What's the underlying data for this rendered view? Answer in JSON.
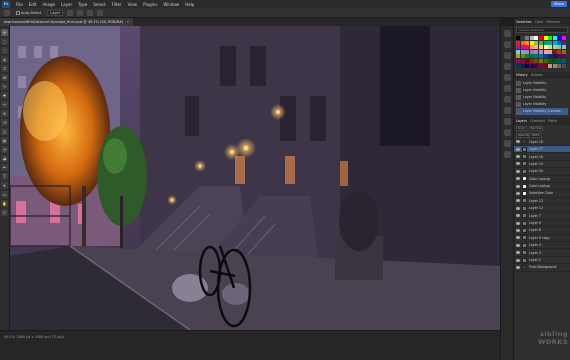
{
  "app": {
    "logo": "Ps"
  },
  "menu": [
    "File",
    "Edit",
    "Image",
    "Layer",
    "Type",
    "Select",
    "Filter",
    "View",
    "Plugins",
    "Window",
    "Help"
  ],
  "share_label": "Share",
  "options_bar": {
    "auto_select_label": "Auto-Select",
    "target_value": "Layer"
  },
  "document_tab": "townhousesWithDistanceCityscape_final.psd @ 49.1% (SS, RGB/8#)",
  "status_text": "49.1%   1980 px x 1080 px (72 ppi)",
  "toolbar": {
    "tools": [
      "move-tool",
      "marquee-tool",
      "lasso-tool",
      "object-select-tool",
      "crop-tool",
      "frame-tool",
      "eyedropper-tool",
      "healing-tool",
      "brush-tool",
      "stamp-tool",
      "history-brush-tool",
      "eraser-tool",
      "gradient-tool",
      "blur-tool",
      "dodge-tool",
      "pen-tool",
      "type-tool",
      "path-select-tool",
      "shape-tool",
      "hand-tool",
      "zoom-tool"
    ],
    "tool_glyphs": [
      "✥",
      "⬚",
      "◌",
      "◍",
      "⌗",
      "⊠",
      "✎",
      "✚",
      "✏",
      "⊕",
      "↺",
      "◫",
      "▦",
      "◔",
      "◕",
      "✒",
      "T",
      "➤",
      "▭",
      "✋",
      "⚲"
    ]
  },
  "right_strip_icons": [
    "color-icon",
    "swatches-icon",
    "gradient-icon",
    "patterns-icon",
    "properties-icon",
    "adjustments-icon",
    "libraries-icon",
    "history-icon",
    "actions-icon",
    "layers-icon",
    "channels-icon",
    "paths-icon"
  ],
  "swatches_panel": {
    "tabs": [
      "Swatches",
      "Color",
      "Patterns"
    ],
    "search_placeholder": "Search Swatches",
    "colors": [
      "#000000",
      "#3a3a3a",
      "#7a7a7a",
      "#b8b8b8",
      "#ffffff",
      "#ff0000",
      "#ffff00",
      "#00ff00",
      "#00ffff",
      "#0000ff",
      "#ff00ff",
      "#ed1c24",
      "#f26522",
      "#f7941d",
      "#fff200",
      "#8dc63f",
      "#39b54a",
      "#00a651",
      "#00a99d",
      "#00aeef",
      "#0072bc",
      "#2e3192",
      "#92278f",
      "#ec008c",
      "#ed145b",
      "#f69679",
      "#f9ad81",
      "#fdc68a",
      "#fff799",
      "#c4df9b",
      "#a3d39c",
      "#82ca9d",
      "#7accc8",
      "#6dcff6",
      "#7da7d9",
      "#8393ca",
      "#8781bd",
      "#a186be",
      "#bd8cbf",
      "#f49ac2",
      "#f6989d",
      "#9e0b0f",
      "#a0410d",
      "#a36209",
      "#aba000",
      "#598527",
      "#1a7b30",
      "#007236",
      "#00746b",
      "#0076a3",
      "#004b80",
      "#003471",
      "#1b1464",
      "#440e62",
      "#630460",
      "#9e005d",
      "#9e0039",
      "#790000",
      "#7b2e00",
      "#7d4900",
      "#827b00",
      "#406618",
      "#005e20",
      "#005826",
      "#005952",
      "#005b7f",
      "#003663",
      "#002157",
      "#0d004c",
      "#32004b",
      "#4b0049",
      "#7b0046",
      "#7a0026",
      "#c69c6d",
      "#998675",
      "#736357",
      "#534741"
    ]
  },
  "history_panel": {
    "tabs": [
      "History",
      "Actions"
    ],
    "items": [
      "Layer Visibility",
      "Layer Visibility",
      "Layer Visibility",
      "Layer Visibility",
      "Layer Visibility (Canvas)"
    ]
  },
  "layers_panel": {
    "tabs": [
      "Layers",
      "Channels",
      "Paths"
    ],
    "filter_label": "Kind",
    "blend_mode": "Normal",
    "opacity_label": "Opacity: 100%",
    "layers": [
      {
        "name": "Layer 18",
        "thumb": "dark"
      },
      {
        "name": "Layer 17",
        "thumb": "normal",
        "selected": true
      },
      {
        "name": "Layer 16",
        "thumb": "normal"
      },
      {
        "name": "Layer 19",
        "thumb": "normal"
      },
      {
        "name": "Layer 20",
        "thumb": "normal"
      },
      {
        "name": "Color Lookup",
        "thumb": "adj"
      },
      {
        "name": "Color Lookup",
        "thumb": "adj"
      },
      {
        "name": "Selective Color",
        "thumb": "adj"
      },
      {
        "name": "Layer 13",
        "thumb": "normal"
      },
      {
        "name": "Layer 12",
        "thumb": "normal"
      },
      {
        "name": "Layer 7",
        "thumb": "normal"
      },
      {
        "name": "Layer 9",
        "thumb": "normal"
      },
      {
        "name": "Layer 8",
        "thumb": "normal"
      },
      {
        "name": "Layer 9 copy",
        "thumb": "normal"
      },
      {
        "name": "Layer 4",
        "thumb": "normal"
      },
      {
        "name": "Layer 3",
        "thumb": "normal"
      },
      {
        "name": "Layer 2",
        "thumb": "normal"
      },
      {
        "name": "Final Background",
        "thumb": "dark"
      }
    ]
  },
  "watermark": {
    "line1": "sibling",
    "line2": "WORKS"
  }
}
